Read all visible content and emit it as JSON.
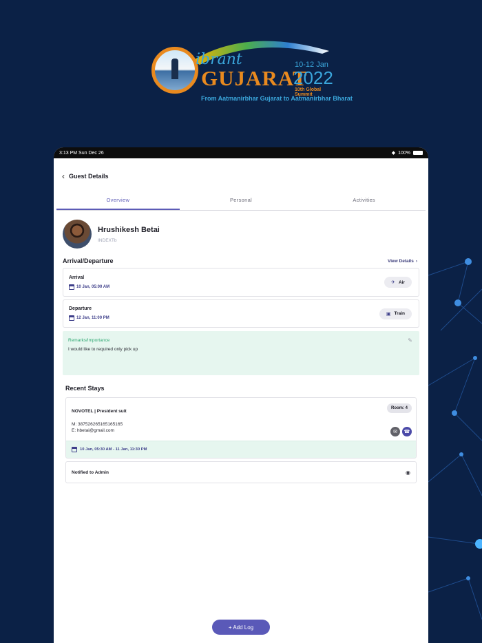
{
  "logo": {
    "word1": "ibrant",
    "word2": "GUJARAT",
    "dates": "10-12 Jan",
    "year": "2022",
    "summit": "10th Global Summit",
    "tagline": "From Aatmanirbhar Gujarat to Aatmanirbhar Bharat"
  },
  "status_bar": {
    "time": "3:13 PM",
    "date": "Sun Dec 26",
    "battery": "100%"
  },
  "header": {
    "title": "Guest Details"
  },
  "tabs": [
    {
      "label": "Overview",
      "active": true
    },
    {
      "label": "Personal",
      "active": false
    },
    {
      "label": "Activities",
      "active": false
    }
  ],
  "guest": {
    "name": "Hrushikesh Betai",
    "org": "INDEXTb"
  },
  "arrival_departure": {
    "title": "Arrival/Departure",
    "view_details": "View Details",
    "arrival": {
      "label": "Arrival",
      "date": "10 Jan, 05:00 AM",
      "mode": "Air"
    },
    "departure": {
      "label": "Departure",
      "date": "12 Jan, 11:00 PM",
      "mode": "Train"
    }
  },
  "remarks": {
    "label": "Remarks/Importance",
    "text": "I would like to required only pick up"
  },
  "recent_stays": {
    "title": "Recent Stays",
    "hotel": "NOVOTEL | President suit",
    "room": "Room: 4",
    "mobile": "M: 387526265165165165",
    "email": "E: hbetai@gmail.com",
    "range": "10 Jan, 05:30 AM - 11 Jan, 11:30 PM"
  },
  "notified": {
    "label": "Notified to Admin"
  },
  "add_log": {
    "label": "+ Add Log"
  },
  "colors": {
    "background": "#0b2146",
    "accent": "#5a59b8",
    "remarks_bg": "#e6f6ef",
    "remarks_label": "#2fa872"
  }
}
